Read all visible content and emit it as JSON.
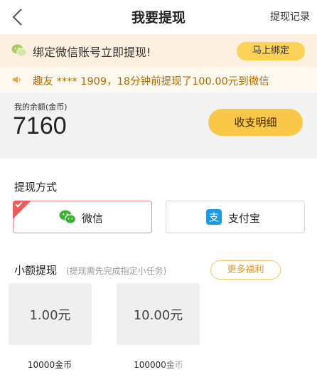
{
  "header": {
    "title": "我要提现",
    "records_link": "提现记录",
    "back_icon": "chevron-left-icon"
  },
  "bind_bar": {
    "icon": "wechat-icon",
    "text": "绑定微信账号立即提现!",
    "button_label": "马上绑定"
  },
  "notice": {
    "icon": "speaker-icon",
    "text": "趣友 **** 1909，18分钟前提现了100.00元到微信"
  },
  "balance": {
    "label": "我的余额(金币)",
    "value": "7160",
    "detail_button": "收支明细"
  },
  "withdraw_method": {
    "title": "提现方式",
    "options": [
      {
        "label": "微信",
        "icon": "wechat-icon",
        "selected": true
      },
      {
        "label": "支付宝",
        "icon": "alipay-icon",
        "selected": false
      }
    ]
  },
  "small_withdraw": {
    "title": "小额提现",
    "note": "(提现需先完成指定小任务)",
    "more_button": "更多福利",
    "amounts": [
      {
        "value": "1.00元",
        "coins": "10000金币"
      },
      {
        "value": "10.00元",
        "coins": "100000金币"
      }
    ]
  },
  "colors": {
    "accent_yellow": "#fbc748",
    "bind_bar_bg": "#fdf0e1",
    "notice_text": "#b36b00",
    "selected_border": "#f08a8a",
    "wechat_green": "#3cb034",
    "alipay_blue": "#1a9be8"
  }
}
